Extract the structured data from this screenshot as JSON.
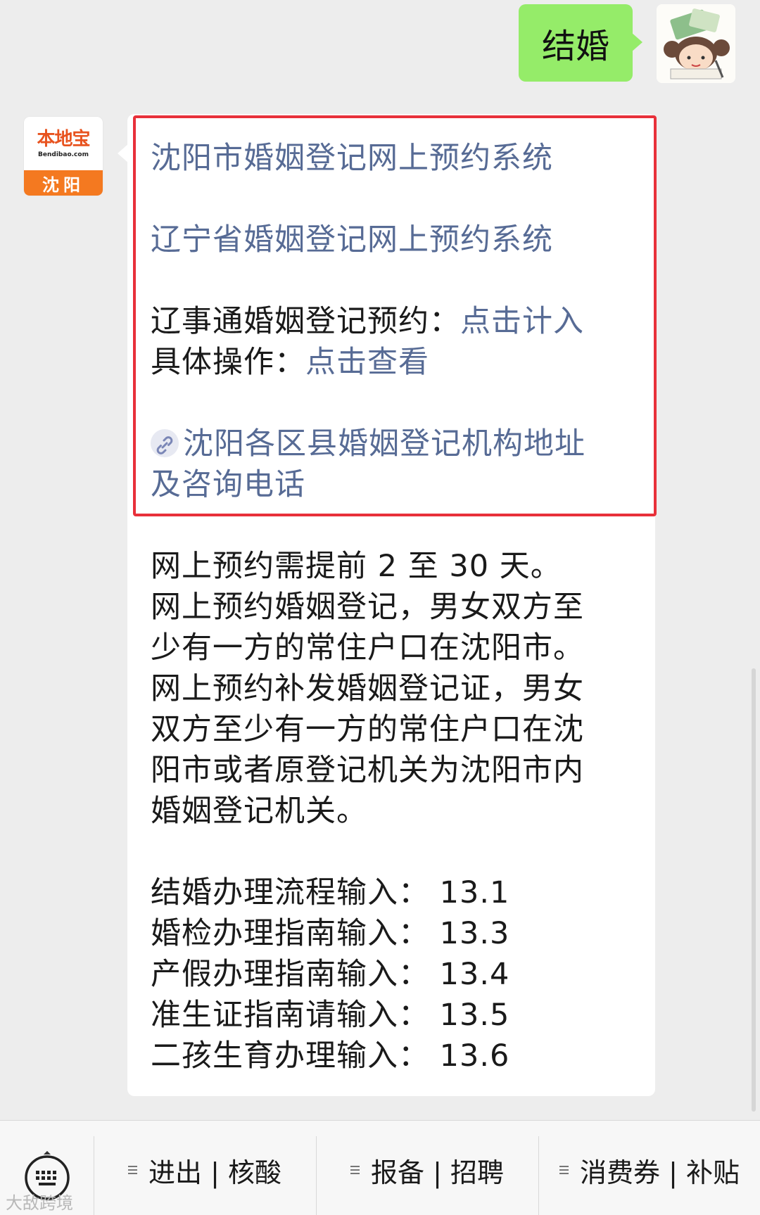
{
  "outgoing": {
    "text": "结婚"
  },
  "bot_avatar": {
    "logo_text": "本地宝",
    "logo_subtext": "Bendibao.com",
    "city": "沈阳"
  },
  "incoming": {
    "links": {
      "shenyang_system": "沈阳市婚姻登记网上预约系统",
      "liaoning_system": "辽宁省婚姻登记网上预约系统"
    },
    "liaoshitong_label": "辽事通婚姻登记预约：",
    "liaoshitong_link": "点击计入",
    "operation_label": "具体操作：",
    "operation_link": "点击查看",
    "address_link_line1": "沈阳各区县婚姻登记机构地址",
    "address_link_line2": "及咨询电话",
    "body_lines": [
      "网上预约需提前 2 至 30 天。",
      "网上预约婚姻登记，男女双方至",
      "少有一方的常住户口在沈阳市。",
      "网上预约补发婚姻登记证，男女",
      "双方至少有一方的常住户口在沈",
      "阳市或者原登记机关为沈阳市内",
      "婚姻登记机关。"
    ],
    "guide_lines": [
      "结婚办理流程输入： 13.1",
      "婚检办理指南输入： 13.3",
      "产假办理指南输入： 13.4",
      "准生证指南请输入： 13.5",
      "二孩生育办理输入： 13.6"
    ]
  },
  "menu": {
    "items": [
      "进出 | 核酸",
      "报备 | 招聘",
      "消费券 | 补贴"
    ]
  },
  "watermark": "大敌跨境",
  "colors": {
    "link": "#576b95",
    "highlight_border": "#e8303a",
    "out_bubble": "#95ec69"
  }
}
